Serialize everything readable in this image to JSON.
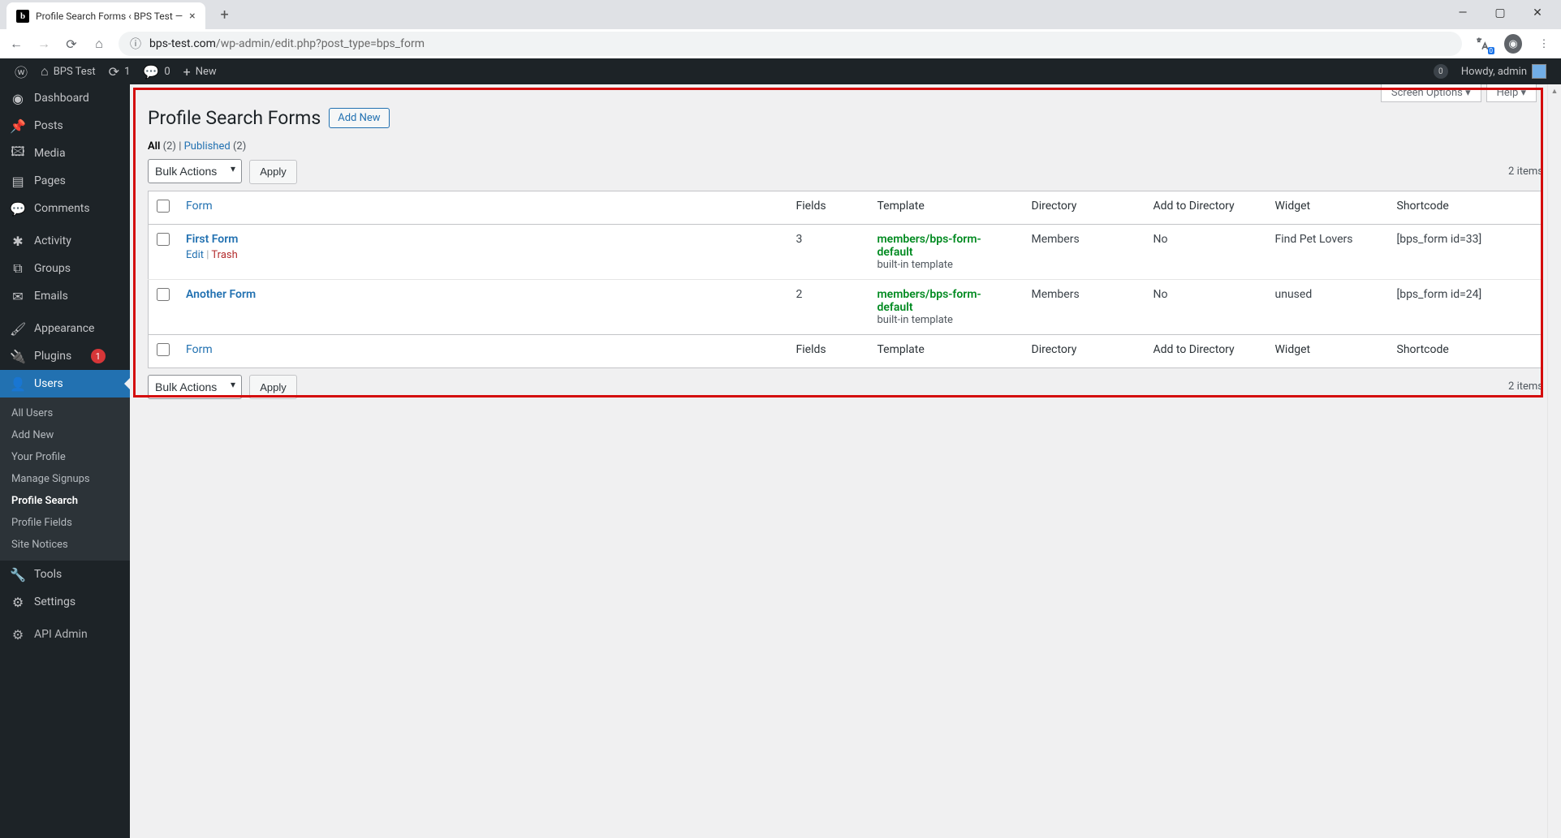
{
  "browser": {
    "tab_title": "Profile Search Forms ‹ BPS Test —",
    "url_host": "bps-test.com",
    "url_path": "/wp-admin/edit.php?post_type=bps_form",
    "translate_count": "0"
  },
  "adminbar": {
    "site": "BPS Test",
    "updates": "1",
    "comments": "0",
    "new": "New",
    "notif": "0",
    "howdy": "Howdy, admin"
  },
  "menu": {
    "dashboard": "Dashboard",
    "posts": "Posts",
    "media": "Media",
    "pages": "Pages",
    "comments": "Comments",
    "activity": "Activity",
    "groups": "Groups",
    "emails": "Emails",
    "appearance": "Appearance",
    "plugins": "Plugins",
    "plugins_count": "1",
    "users": "Users",
    "tools": "Tools",
    "settings": "Settings",
    "apiadmin": "API Admin",
    "sub": {
      "all_users": "All Users",
      "add_new": "Add New",
      "your_profile": "Your Profile",
      "manage_signups": "Manage Signups",
      "profile_search": "Profile Search",
      "profile_fields": "Profile Fields",
      "site_notices": "Site Notices"
    }
  },
  "screen_meta": {
    "screen_options": "Screen Options",
    "help": "Help"
  },
  "page": {
    "title": "Profile Search Forms",
    "add_new": "Add New",
    "filters": {
      "all": "All",
      "all_count": "(2)",
      "published": "Published",
      "pub_count": "(2)",
      "sep": " | "
    },
    "bulk_label": "Bulk Actions",
    "apply": "Apply",
    "items_count": "2 items"
  },
  "columns": {
    "form": "Form",
    "fields": "Fields",
    "template": "Template",
    "directory": "Directory",
    "add": "Add to Directory",
    "widget": "Widget",
    "shortcode": "Shortcode"
  },
  "rows": [
    {
      "title": "First Form",
      "show_actions": true,
      "edit": "Edit",
      "trash": "Trash",
      "fields": "3",
      "template": "members/bps-form-default",
      "template_sub": "built-in template",
      "directory": "Members",
      "add": "No",
      "widget": "Find Pet Lovers",
      "shortcode": "[bps_form id=33]"
    },
    {
      "title": "Another Form",
      "show_actions": false,
      "fields": "2",
      "template": "members/bps-form-default",
      "template_sub": "built-in template",
      "directory": "Members",
      "add": "No",
      "widget": "unused",
      "shortcode": "[bps_form id=24]"
    }
  ]
}
